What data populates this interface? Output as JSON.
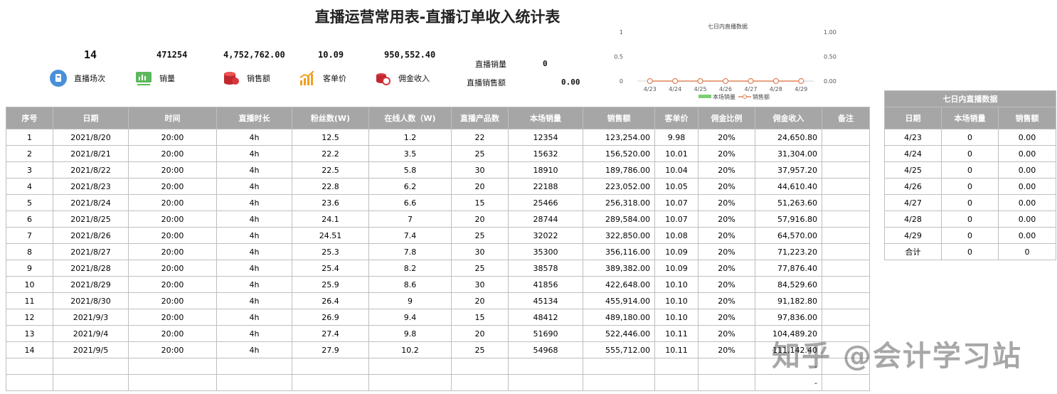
{
  "title": "直播运营常用表-直播订单收入统计表",
  "kpis": {
    "sessions": {
      "value": "14",
      "label": "直播场次"
    },
    "sales": {
      "value": "471254",
      "label": "销量"
    },
    "revenue": {
      "value": "4,752,762.00",
      "label": "销售额"
    },
    "avg_price": {
      "value": "10.09",
      "label": "客单价"
    },
    "commission": {
      "value": "950,552.40",
      "label": "佣金收入"
    }
  },
  "side_kpis": {
    "sales_label": "直播销量",
    "sales_value": "0",
    "revenue_label": "直播销售额",
    "revenue_value": "0.00"
  },
  "chart_data": {
    "type": "line",
    "title": "七日内直播数据",
    "categories": [
      "4/23",
      "4/24",
      "4/25",
      "4/26",
      "4/27",
      "4/28",
      "4/29"
    ],
    "series": [
      {
        "name": "本场销量",
        "values": [
          0,
          0,
          0,
          0,
          0,
          0,
          0
        ],
        "kind": "bar",
        "color": "#7ccf72"
      },
      {
        "name": "销售额",
        "values": [
          0,
          0,
          0,
          0,
          0,
          0,
          0
        ],
        "kind": "line",
        "color": "#e0835a"
      }
    ],
    "left_ticks": [
      "1",
      "0.5",
      "0"
    ],
    "right_ticks": [
      "1.00",
      "0.50",
      "0.00"
    ],
    "ylim": [
      0,
      1
    ],
    "legend": "bottom"
  },
  "main_table": {
    "headers": [
      "序号",
      "日期",
      "时间",
      "直播时长",
      "粉丝数(W)",
      "在线人数（W)",
      "直播产品数",
      "本场销量",
      "销售额",
      "客单价",
      "佣金比例",
      "佣金收入",
      "备注"
    ],
    "rows": [
      [
        "1",
        "2021/8/20",
        "20:00",
        "4h",
        "12.5",
        "1.2",
        "22",
        "12354",
        "123,254.00",
        "9.98",
        "20%",
        "24,650.80",
        ""
      ],
      [
        "2",
        "2021/8/21",
        "20:00",
        "4h",
        "22.2",
        "3.5",
        "25",
        "15632",
        "156,520.00",
        "10.01",
        "20%",
        "31,304.00",
        ""
      ],
      [
        "3",
        "2021/8/22",
        "20:00",
        "4h",
        "22.5",
        "5.8",
        "30",
        "18910",
        "189,786.00",
        "10.04",
        "20%",
        "37,957.20",
        ""
      ],
      [
        "4",
        "2021/8/23",
        "20:00",
        "4h",
        "22.8",
        "6.2",
        "20",
        "22188",
        "223,052.00",
        "10.05",
        "20%",
        "44,610.40",
        ""
      ],
      [
        "5",
        "2021/8/24",
        "20:00",
        "4h",
        "23.6",
        "6.6",
        "15",
        "25466",
        "256,318.00",
        "10.07",
        "20%",
        "51,263.60",
        ""
      ],
      [
        "6",
        "2021/8/25",
        "20:00",
        "4h",
        "24.1",
        "7",
        "20",
        "28744",
        "289,584.00",
        "10.07",
        "20%",
        "57,916.80",
        ""
      ],
      [
        "7",
        "2021/8/26",
        "20:00",
        "4h",
        "24.51",
        "7.4",
        "25",
        "32022",
        "322,850.00",
        "10.08",
        "20%",
        "64,570.00",
        ""
      ],
      [
        "8",
        "2021/8/27",
        "20:00",
        "4h",
        "25.3",
        "7.8",
        "30",
        "35300",
        "356,116.00",
        "10.09",
        "20%",
        "71,223.20",
        ""
      ],
      [
        "9",
        "2021/8/28",
        "20:00",
        "4h",
        "25.4",
        "8.2",
        "25",
        "38578",
        "389,382.00",
        "10.09",
        "20%",
        "77,876.40",
        ""
      ],
      [
        "10",
        "2021/8/29",
        "20:00",
        "4h",
        "25.9",
        "8.6",
        "30",
        "41856",
        "422,648.00",
        "10.10",
        "20%",
        "84,529.60",
        ""
      ],
      [
        "11",
        "2021/8/30",
        "20:00",
        "4h",
        "26.4",
        "9",
        "20",
        "45134",
        "455,914.00",
        "10.10",
        "20%",
        "91,182.80",
        ""
      ],
      [
        "12",
        "2021/9/3",
        "20:00",
        "4h",
        "26.9",
        "9.4",
        "15",
        "48412",
        "489,180.00",
        "10.10",
        "20%",
        "97,836.00",
        ""
      ],
      [
        "13",
        "2021/9/4",
        "20:00",
        "4h",
        "27.4",
        "9.8",
        "20",
        "51690",
        "522,446.00",
        "10.11",
        "20%",
        "104,489.20",
        ""
      ],
      [
        "14",
        "2021/9/5",
        "20:00",
        "4h",
        "27.9",
        "10.2",
        "25",
        "54968",
        "555,712.00",
        "10.11",
        "20%",
        "111,142.40",
        ""
      ],
      [
        "",
        "",
        "",
        "",
        "",
        "",
        "",
        "",
        "",
        "",
        "",
        "-",
        ""
      ],
      [
        "",
        "",
        "",
        "",
        "",
        "",
        "",
        "",
        "",
        "",
        "",
        "-",
        ""
      ]
    ]
  },
  "side_table": {
    "caption": "七日内直播数据",
    "headers": [
      "日期",
      "本场销量",
      "销售额"
    ],
    "rows": [
      [
        "4/23",
        "0",
        "0.00"
      ],
      [
        "4/24",
        "0",
        "0.00"
      ],
      [
        "4/25",
        "0",
        "0.00"
      ],
      [
        "4/26",
        "0",
        "0.00"
      ],
      [
        "4/27",
        "0",
        "0.00"
      ],
      [
        "4/28",
        "0",
        "0.00"
      ],
      [
        "4/29",
        "0",
        "0.00"
      ],
      [
        "合计",
        "0",
        "0"
      ]
    ]
  },
  "watermark": "知乎 @会计学习站",
  "colors": {
    "header_bg": "#a6a6a6",
    "grid": "#bfbfbf",
    "bar_green": "#7ccf72",
    "line_orange": "#e0835a"
  }
}
